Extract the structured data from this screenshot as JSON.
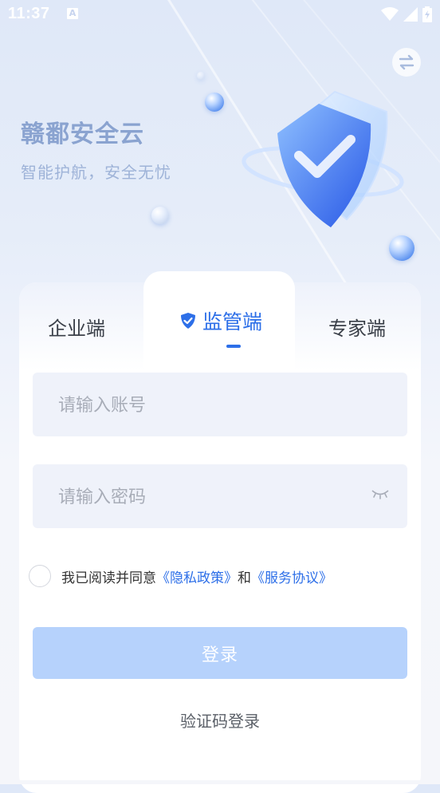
{
  "status_bar": {
    "time": "11:37",
    "badge": "A"
  },
  "brand": {
    "title": "赣鄱安全云",
    "subtitle": "智能护航，安全无忧"
  },
  "tabs": [
    {
      "label": "企业端",
      "active": false
    },
    {
      "label": "监管端",
      "active": true
    },
    {
      "label": "专家端",
      "active": false
    }
  ],
  "form": {
    "account_placeholder": "请输入账号",
    "password_placeholder": "请输入密码"
  },
  "agreement": {
    "prefix": "我已阅读并同意",
    "privacy": "《隐私政策》",
    "and": "和",
    "service": "《服务协议》"
  },
  "login_button": "登录",
  "sms_login": "验证码登录",
  "colors": {
    "accent": "#2d6fe8",
    "button_disabled": "#b6d2fc",
    "input_bg": "#eff2fa"
  },
  "icons": {
    "switch": "swap-arrows-icon",
    "tab_active": "shield-check-icon",
    "password_toggle": "eye-closed-icon"
  }
}
